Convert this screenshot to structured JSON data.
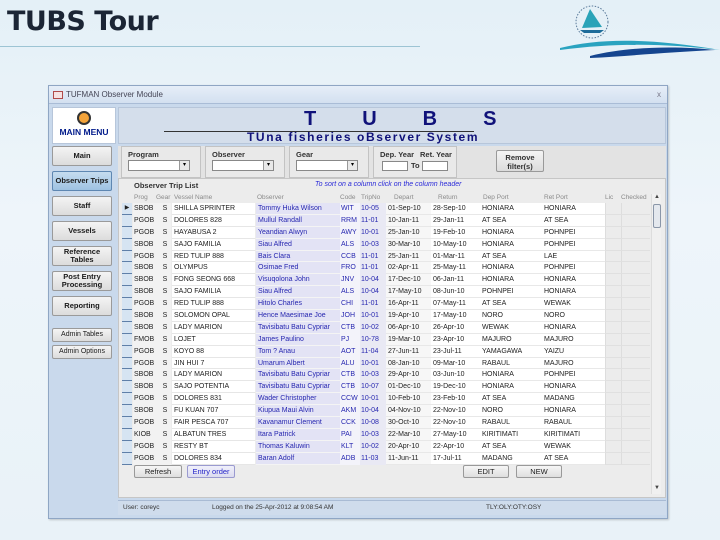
{
  "slide": {
    "title": "TUBS Tour"
  },
  "window": {
    "title": "TUFMAN Observer Module",
    "close_glyph": "x"
  },
  "menu": {
    "logo_label": "MAIN MENU",
    "items": [
      {
        "label": "Main",
        "active": false
      },
      {
        "label": "Observer Trips",
        "active": true
      },
      {
        "label": "Staff",
        "active": false
      },
      {
        "label": "Vessels",
        "active": false
      },
      {
        "label": "Reference Tables",
        "active": false
      },
      {
        "label": "Post Entry Processing",
        "active": false
      },
      {
        "label": "Reporting",
        "active": false
      }
    ],
    "admin_items": [
      {
        "label": "Admin Tables"
      },
      {
        "label": "Admin Options"
      }
    ]
  },
  "banner": {
    "title": "TUBS",
    "subtitle": "TUna fisheries oBserver System"
  },
  "filters": {
    "program_label": "Program",
    "program_value": "",
    "observer_label": "Observer",
    "observer_value": "",
    "gear_label": "Gear",
    "gear_value": "",
    "dep_year_label": "Dep. Year",
    "ret_year_label": "Ret. Year",
    "to_label": "To",
    "dep_year_value": "",
    "ret_year_value": "",
    "remove_label": "Remove filter(s)"
  },
  "trip_list": {
    "title": "Observer Trip List",
    "sort_hint": "To sort on a column click on the column header",
    "columns": [
      "Prog",
      "Gear",
      "Vessel Name",
      "Observer",
      "Code",
      "TripNo",
      "Depart",
      "Return",
      "Dep Port",
      "Ret Port",
      "Lic",
      "Checked"
    ],
    "rows": [
      {
        "prog": "SBOB",
        "gear": "S",
        "vessel": "SHILLA SPRINTER",
        "observer": "Tommy Huka Wilson",
        "code": "WIT",
        "trip": "10-05",
        "depart": "01-Sep-10",
        "return": "28-Sep-10",
        "dep_port": "HONIARA",
        "ret_port": "HONIARA",
        "current": true
      },
      {
        "prog": "PGOB",
        "gear": "S",
        "vessel": "DOLORES 828",
        "observer": "Mullul Randall",
        "code": "RRM",
        "trip": "11-01",
        "depart": "10-Jan-11",
        "return": "29-Jan-11",
        "dep_port": "AT SEA",
        "ret_port": "AT SEA"
      },
      {
        "prog": "PGOB",
        "gear": "S",
        "vessel": "HAYABUSA 2",
        "observer": "Yeandian Alwyn",
        "code": "AWY",
        "trip": "10-01",
        "depart": "25-Jan-10",
        "return": "19-Feb-10",
        "dep_port": "HONIARA",
        "ret_port": "POHNPEI"
      },
      {
        "prog": "SBOB",
        "gear": "S",
        "vessel": "SAJO FAMILIA",
        "observer": "Siau Alfred",
        "code": "ALS",
        "trip": "10-03",
        "depart": "30-Mar-10",
        "return": "10-May-10",
        "dep_port": "HONIARA",
        "ret_port": "POHNPEI"
      },
      {
        "prog": "PGOB",
        "gear": "S",
        "vessel": "RED TULIP 888",
        "observer": "Bais Clara",
        "code": "CCB",
        "trip": "11-01",
        "depart": "25-Jan-11",
        "return": "01-Mar-11",
        "dep_port": "AT SEA",
        "ret_port": "LAE"
      },
      {
        "prog": "SBOB",
        "gear": "S",
        "vessel": "OLYMPUS",
        "observer": "Osimae Fred",
        "code": "FRO",
        "trip": "11-01",
        "depart": "02-Apr-11",
        "return": "25-May-11",
        "dep_port": "HONIARA",
        "ret_port": "POHNPEI"
      },
      {
        "prog": "SBOB",
        "gear": "S",
        "vessel": "FONG SEONG 668",
        "observer": "Visuqolona John",
        "code": "JNV",
        "trip": "10-04",
        "depart": "17-Dec-10",
        "return": "06-Jan-11",
        "dep_port": "HONIARA",
        "ret_port": "HONIARA"
      },
      {
        "prog": "SBOB",
        "gear": "S",
        "vessel": "SAJO FAMILIA",
        "observer": "Siau Alfred",
        "code": "ALS",
        "trip": "10-04",
        "depart": "17-May-10",
        "return": "08-Jun-10",
        "dep_port": "POHNPEI",
        "ret_port": "HONIARA"
      },
      {
        "prog": "PGOB",
        "gear": "S",
        "vessel": "RED TULIP 888",
        "observer": "Hitolo Charles",
        "code": "CHI",
        "trip": "11-01",
        "depart": "16-Apr-11",
        "return": "07-May-11",
        "dep_port": "AT SEA",
        "ret_port": "WEWAK"
      },
      {
        "prog": "SBOB",
        "gear": "S",
        "vessel": "SOLOMON OPAL",
        "observer": "Hence Maesimae Joe",
        "code": "JOH",
        "trip": "10-01",
        "depart": "19-Apr-10",
        "return": "17-May-10",
        "dep_port": "NORO",
        "ret_port": "NORO"
      },
      {
        "prog": "SBOB",
        "gear": "S",
        "vessel": "LADY MARION",
        "observer": "Tavisibatu Batu Cypriar",
        "code": "CTB",
        "trip": "10-02",
        "depart": "06-Apr-10",
        "return": "26-Apr-10",
        "dep_port": "WEWAK",
        "ret_port": "HONIARA"
      },
      {
        "prog": "FMOB",
        "gear": "S",
        "vessel": "LOJET",
        "observer": "James Paulino",
        "code": "PJ",
        "trip": "10-78",
        "depart": "19-Mar-10",
        "return": "23-Apr-10",
        "dep_port": "MAJURO",
        "ret_port": "MAJURO"
      },
      {
        "prog": "PGOB",
        "gear": "S",
        "vessel": "KOYO 88",
        "observer": "Tom ? Anau",
        "code": "AOT",
        "trip": "11-04",
        "depart": "27-Jun-11",
        "return": "23-Jul-11",
        "dep_port": "YAMAGAWA",
        "ret_port": "YAIZU"
      },
      {
        "prog": "PGOB",
        "gear": "S",
        "vessel": "JIN HUI 7",
        "observer": "Umarum Albert",
        "code": "ALU",
        "trip": "10-01",
        "depart": "08-Jan-10",
        "return": "09-Mar-10",
        "dep_port": "RABAUL",
        "ret_port": "MAJURO"
      },
      {
        "prog": "SBOB",
        "gear": "S",
        "vessel": "LADY MARION",
        "observer": "Tavisibatu Batu Cypriar",
        "code": "CTB",
        "trip": "10-03",
        "depart": "29-Apr-10",
        "return": "03-Jun-10",
        "dep_port": "HONIARA",
        "ret_port": "POHNPEI"
      },
      {
        "prog": "SBOB",
        "gear": "S",
        "vessel": "SAJO POTENTIA",
        "observer": "Tavisibatu Batu Cypriar",
        "code": "CTB",
        "trip": "10-07",
        "depart": "01-Dec-10",
        "return": "19-Dec-10",
        "dep_port": "HONIARA",
        "ret_port": "HONIARA"
      },
      {
        "prog": "PGOB",
        "gear": "S",
        "vessel": "DOLORES 831",
        "observer": "Wader Christopher",
        "code": "CCW",
        "trip": "10-01",
        "depart": "10-Feb-10",
        "return": "23-Feb-10",
        "dep_port": "AT SEA",
        "ret_port": "MADANG"
      },
      {
        "prog": "SBOB",
        "gear": "S",
        "vessel": "FU KUAN 707",
        "observer": "Kiupua Maui Alvin",
        "code": "AKM",
        "trip": "10-04",
        "depart": "04-Nov-10",
        "return": "22-Nov-10",
        "dep_port": "NORO",
        "ret_port": "HONIARA"
      },
      {
        "prog": "PGOB",
        "gear": "S",
        "vessel": "FAIR PESCA 707",
        "observer": "Kavanamur Clement",
        "code": "CCK",
        "trip": "10-08",
        "depart": "30-Oct-10",
        "return": "22-Nov-10",
        "dep_port": "RABAUL",
        "ret_port": "RABAUL"
      },
      {
        "prog": "KIOB",
        "gear": "S",
        "vessel": "ALBATUN TRES",
        "observer": "Itara Patrick",
        "code": "PAI",
        "trip": "10-03",
        "depart": "22-Mar-10",
        "return": "27-May-10",
        "dep_port": "KIRITIMATI",
        "ret_port": "KIRITIMATI"
      },
      {
        "prog": "PGOB",
        "gear": "S",
        "vessel": "RESTY BT",
        "observer": "Thomas Kaluwin",
        "code": "KLT",
        "trip": "10-02",
        "depart": "20-Apr-10",
        "return": "22-Apr-10",
        "dep_port": "AT SEA",
        "ret_port": "WEWAK"
      },
      {
        "prog": "PGOB",
        "gear": "S",
        "vessel": "DOLORES 834",
        "observer": "Baran Adolf",
        "code": "ADB",
        "trip": "11-03",
        "depart": "11-Jun-11",
        "return": "17-Jul-11",
        "dep_port": "MADANG",
        "ret_port": "AT SEA"
      }
    ],
    "refresh_label": "Refresh",
    "entry_order_label": "Entry order",
    "edit_label": "EDIT",
    "new_label": "NEW"
  },
  "status": {
    "user": "User: coreyc",
    "logged": "Logged on the 25-Apr-2012 at 9:08:54 AM",
    "codes": "TLY:OLY:OTY:OSY"
  },
  "icons": {
    "record_selector": "▶",
    "dropdown": "▾",
    "scroll_up": "▲",
    "scroll_down": "▼"
  }
}
